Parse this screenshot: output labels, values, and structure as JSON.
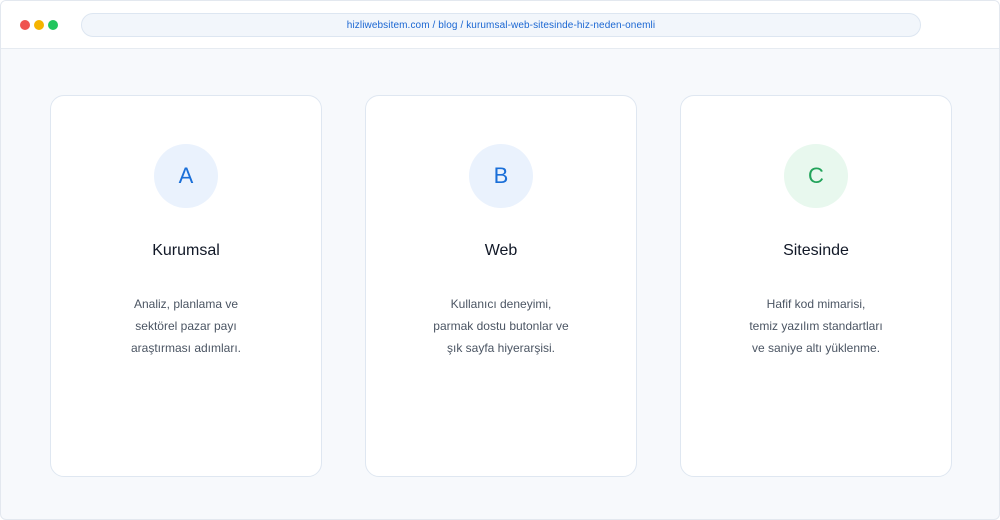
{
  "browser": {
    "url": "hizliwebsitem.com / blog / kurumsal-web-sitesinde-hiz-neden-onemli"
  },
  "cards": [
    {
      "badge": "A",
      "title": "Kurumsal",
      "lines": [
        "Analiz, planlama ve",
        "sektörel pazar payı",
        "araştırması adımları."
      ]
    },
    {
      "badge": "B",
      "title": "Web",
      "lines": [
        "Kullanıcı deneyimi,",
        "parmak dostu butonlar ve",
        "şık sayfa hiyerarşisi."
      ]
    },
    {
      "badge": "C",
      "title": "Sitesinde",
      "lines": [
        "Hafif kod mimarisi,",
        "temiz yazılım standartları",
        "ve saniye altı yüklenme."
      ]
    }
  ],
  "colors": {
    "accent_blue": "#1a6fd8",
    "accent_green": "#22a35a"
  }
}
